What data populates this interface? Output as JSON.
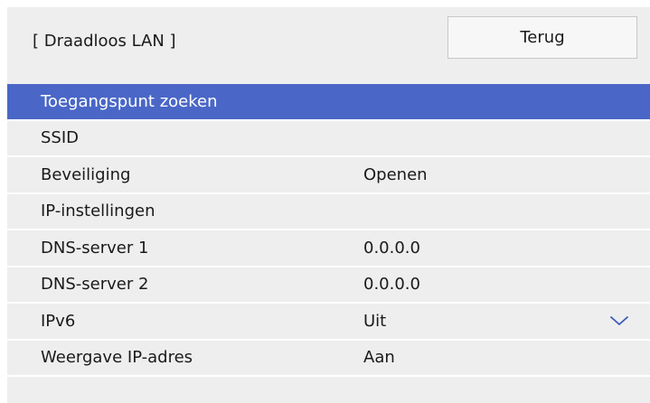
{
  "header": {
    "title": "[ Draadloos LAN ]",
    "back_label": "Terug"
  },
  "menu": {
    "items": [
      {
        "label": "Toegangspunt zoeken",
        "value": "",
        "selected": true
      },
      {
        "label": "SSID",
        "value": ""
      },
      {
        "label": "Beveiliging",
        "value": "Openen"
      },
      {
        "label": "IP-instellingen",
        "value": ""
      },
      {
        "label": "DNS-server 1",
        "value": "0.0.0.0"
      },
      {
        "label": "DNS-server 2",
        "value": "0.0.0.0"
      },
      {
        "label": "IPv6",
        "value": "Uit"
      },
      {
        "label": "Weergave IP-adres",
        "value": "Aan"
      }
    ],
    "scroll_indicator": "chevron-down-icon"
  },
  "colors": {
    "panel_background": "#eeeeee",
    "selected_background": "#4a67c7",
    "selected_text": "#ffffff",
    "divider": "#ffffff",
    "chevron": "#3b5bb8"
  }
}
